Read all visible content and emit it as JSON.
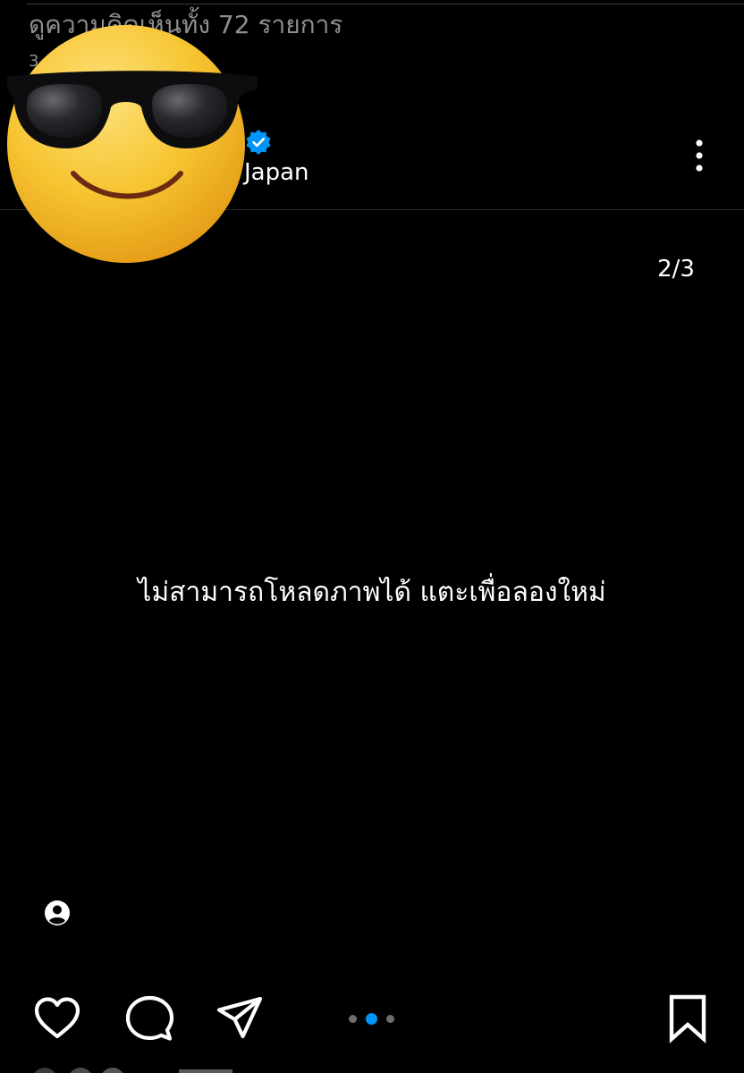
{
  "header": {
    "view_all_comments": "ดูความคิดเห็นทั้ง 72 รายการ",
    "time_ago": "3",
    "location": "Japan",
    "verified_icon": "verified-badge-icon",
    "more_icon": "more-vertical-icon"
  },
  "media": {
    "page_counter": "2/3",
    "error_message": "ไม่สามารถโหลดภาพได้ แตะเพื่อลองใหม่",
    "tags_icon": "user-tag-icon",
    "current_page": 2,
    "total_pages": 3
  },
  "actions": {
    "like_icon": "heart-icon",
    "comment_icon": "comment-bubble-icon",
    "share_icon": "paper-plane-icon",
    "save_icon": "bookmark-icon"
  },
  "overlay": {
    "emoji": "sunglasses-smiley-emoji"
  },
  "colors": {
    "background": "#000000",
    "accent": "#0095f6",
    "secondary_text": "#8e8e8e",
    "emoji_face": "#f7c431"
  }
}
